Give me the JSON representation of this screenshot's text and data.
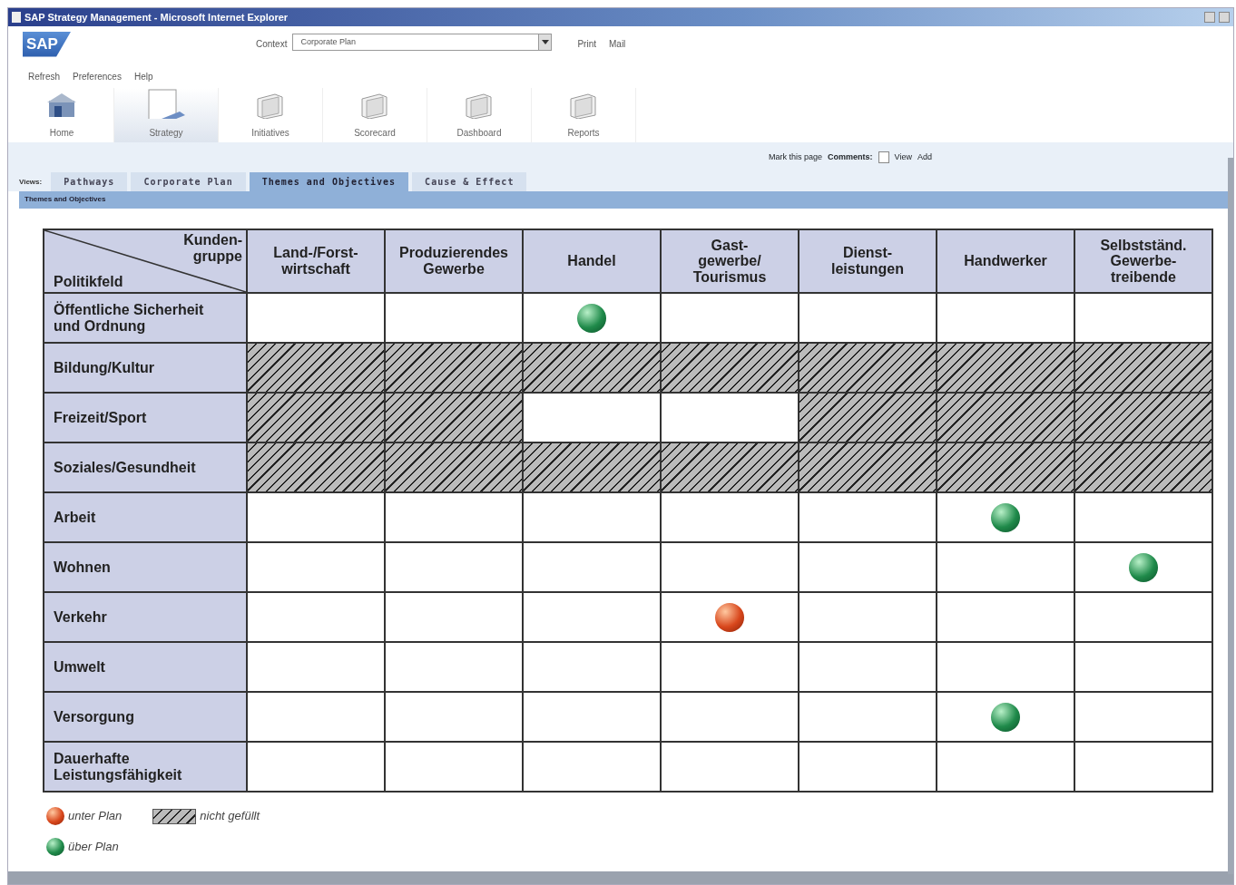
{
  "window": {
    "title": "SAP Strategy Management - Microsoft Internet Explorer"
  },
  "header": {
    "logo": "SAP",
    "context_label": "Context",
    "context_value": "Corporate Plan",
    "links": [
      "Print",
      "Mail"
    ],
    "menu": [
      "Refresh",
      "Preferences",
      "Help"
    ]
  },
  "toolbar": [
    {
      "label": "Home",
      "kind": "home",
      "selected": false
    },
    {
      "label": "Strategy",
      "kind": "strategy",
      "selected": true
    },
    {
      "label": "Initiatives",
      "kind": "folder",
      "selected": false
    },
    {
      "label": "Scorecard",
      "kind": "folder",
      "selected": false
    },
    {
      "label": "Dashboard",
      "kind": "folder",
      "selected": false
    },
    {
      "label": "Reports",
      "kind": "folder",
      "selected": false
    }
  ],
  "page_links": {
    "mark": "Mark this page",
    "comments_label": "Comments:",
    "view": "View",
    "add": "Add"
  },
  "views_label": "Views:",
  "tabs": [
    {
      "label": "Pathways",
      "selected": false
    },
    {
      "label": "Corporate Plan",
      "selected": false
    },
    {
      "label": "Themes and Objectives",
      "selected": true
    },
    {
      "label": "Cause & Effect",
      "selected": false
    }
  ],
  "section_title": "Themes and Objectives",
  "table": {
    "corner_top": "Kunden-\ngruppe",
    "corner_bottom": "Politikfeld",
    "columns": [
      "Land-/Forst-\nwirtschaft",
      "Produzierendes\nGewerbe",
      "Handel",
      "Gast-\ngewerbe/\nTourismus",
      "Dienst-\nleistungen",
      "Handwerker",
      "Selbstständ.\nGewerbe-\ntreibende"
    ],
    "rows": [
      {
        "label": "Öffentliche Sicherheit\nund Ordnung",
        "cells": [
          {
            "kind": "empty"
          },
          {
            "kind": "empty"
          },
          {
            "kind": "above"
          },
          {
            "kind": "empty"
          },
          {
            "kind": "empty"
          },
          {
            "kind": "empty"
          },
          {
            "kind": "empty"
          }
        ]
      },
      {
        "label": "Bildung/Kultur",
        "cells": [
          {
            "kind": "hatched"
          },
          {
            "kind": "hatched"
          },
          {
            "kind": "hatched"
          },
          {
            "kind": "hatched"
          },
          {
            "kind": "hatched"
          },
          {
            "kind": "hatched"
          },
          {
            "kind": "hatched"
          }
        ]
      },
      {
        "label": "Freizeit/Sport",
        "cells": [
          {
            "kind": "hatched"
          },
          {
            "kind": "hatched"
          },
          {
            "kind": "empty"
          },
          {
            "kind": "empty"
          },
          {
            "kind": "hatched"
          },
          {
            "kind": "hatched"
          },
          {
            "kind": "hatched"
          }
        ]
      },
      {
        "label": "Soziales/Gesundheit",
        "cells": [
          {
            "kind": "hatched"
          },
          {
            "kind": "hatched"
          },
          {
            "kind": "hatched"
          },
          {
            "kind": "hatched"
          },
          {
            "kind": "hatched"
          },
          {
            "kind": "hatched"
          },
          {
            "kind": "hatched"
          }
        ]
      },
      {
        "label": "Arbeit",
        "cells": [
          {
            "kind": "empty"
          },
          {
            "kind": "empty"
          },
          {
            "kind": "empty"
          },
          {
            "kind": "empty"
          },
          {
            "kind": "empty"
          },
          {
            "kind": "above"
          },
          {
            "kind": "empty"
          }
        ]
      },
      {
        "label": "Wohnen",
        "cells": [
          {
            "kind": "empty"
          },
          {
            "kind": "empty"
          },
          {
            "kind": "empty"
          },
          {
            "kind": "empty"
          },
          {
            "kind": "empty"
          },
          {
            "kind": "empty"
          },
          {
            "kind": "above"
          }
        ]
      },
      {
        "label": "Verkehr",
        "cells": [
          {
            "kind": "empty"
          },
          {
            "kind": "empty"
          },
          {
            "kind": "empty"
          },
          {
            "kind": "below"
          },
          {
            "kind": "empty"
          },
          {
            "kind": "empty"
          },
          {
            "kind": "empty"
          }
        ]
      },
      {
        "label": "Umwelt",
        "cells": [
          {
            "kind": "empty"
          },
          {
            "kind": "empty"
          },
          {
            "kind": "empty"
          },
          {
            "kind": "empty"
          },
          {
            "kind": "empty"
          },
          {
            "kind": "empty"
          },
          {
            "kind": "empty"
          }
        ]
      },
      {
        "label": "Versorgung",
        "cells": [
          {
            "kind": "empty"
          },
          {
            "kind": "empty"
          },
          {
            "kind": "empty"
          },
          {
            "kind": "empty"
          },
          {
            "kind": "empty"
          },
          {
            "kind": "above"
          },
          {
            "kind": "empty"
          }
        ]
      },
      {
        "label": "Dauerhafte\nLeistungsfähigkeit",
        "cells": [
          {
            "kind": "empty"
          },
          {
            "kind": "empty"
          },
          {
            "kind": "empty"
          },
          {
            "kind": "empty"
          },
          {
            "kind": "empty"
          },
          {
            "kind": "empty"
          },
          {
            "kind": "empty"
          }
        ]
      }
    ]
  },
  "legend": [
    {
      "kind": "below",
      "label": "unter Plan"
    },
    {
      "kind": "hatched",
      "label": "nicht gefüllt"
    },
    {
      "kind": "above",
      "label": "über Plan"
    }
  ]
}
